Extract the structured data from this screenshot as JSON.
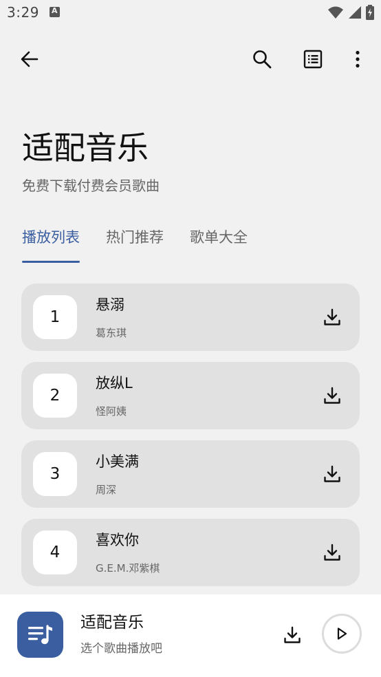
{
  "status_bar": {
    "time": "3:29",
    "icons": [
      "notification-a-icon",
      "wifi-icon",
      "signal-icon",
      "battery-charging-icon"
    ]
  },
  "app_bar": {
    "icons": [
      "back-arrow-icon",
      "search-icon",
      "list-icon",
      "more-vert-icon"
    ]
  },
  "header": {
    "title": "适配音乐",
    "subtitle": "免费下载付费会员歌曲"
  },
  "tabs": [
    {
      "label": "播放列表",
      "active": true
    },
    {
      "label": "热门推荐",
      "active": false
    },
    {
      "label": "歌单大全",
      "active": false
    }
  ],
  "songs": [
    {
      "number": "1",
      "title": "悬溺",
      "artist": "葛东琪"
    },
    {
      "number": "2",
      "title": "放纵L",
      "artist": "怪阿姨"
    },
    {
      "number": "3",
      "title": "小美满",
      "artist": "周深"
    },
    {
      "number": "4",
      "title": "喜欢你",
      "artist": "G.E.M.邓紫棋"
    }
  ],
  "player": {
    "title": "适配音乐",
    "subtitle": "选个歌曲播放吧",
    "icons": [
      "music-queue-icon",
      "download-icon",
      "play-icon"
    ]
  },
  "colors": {
    "accent": "#3a5ea0",
    "background": "#f1f1f1",
    "card": "#e1e1e1",
    "text_primary": "#111111",
    "text_secondary": "#666666"
  }
}
